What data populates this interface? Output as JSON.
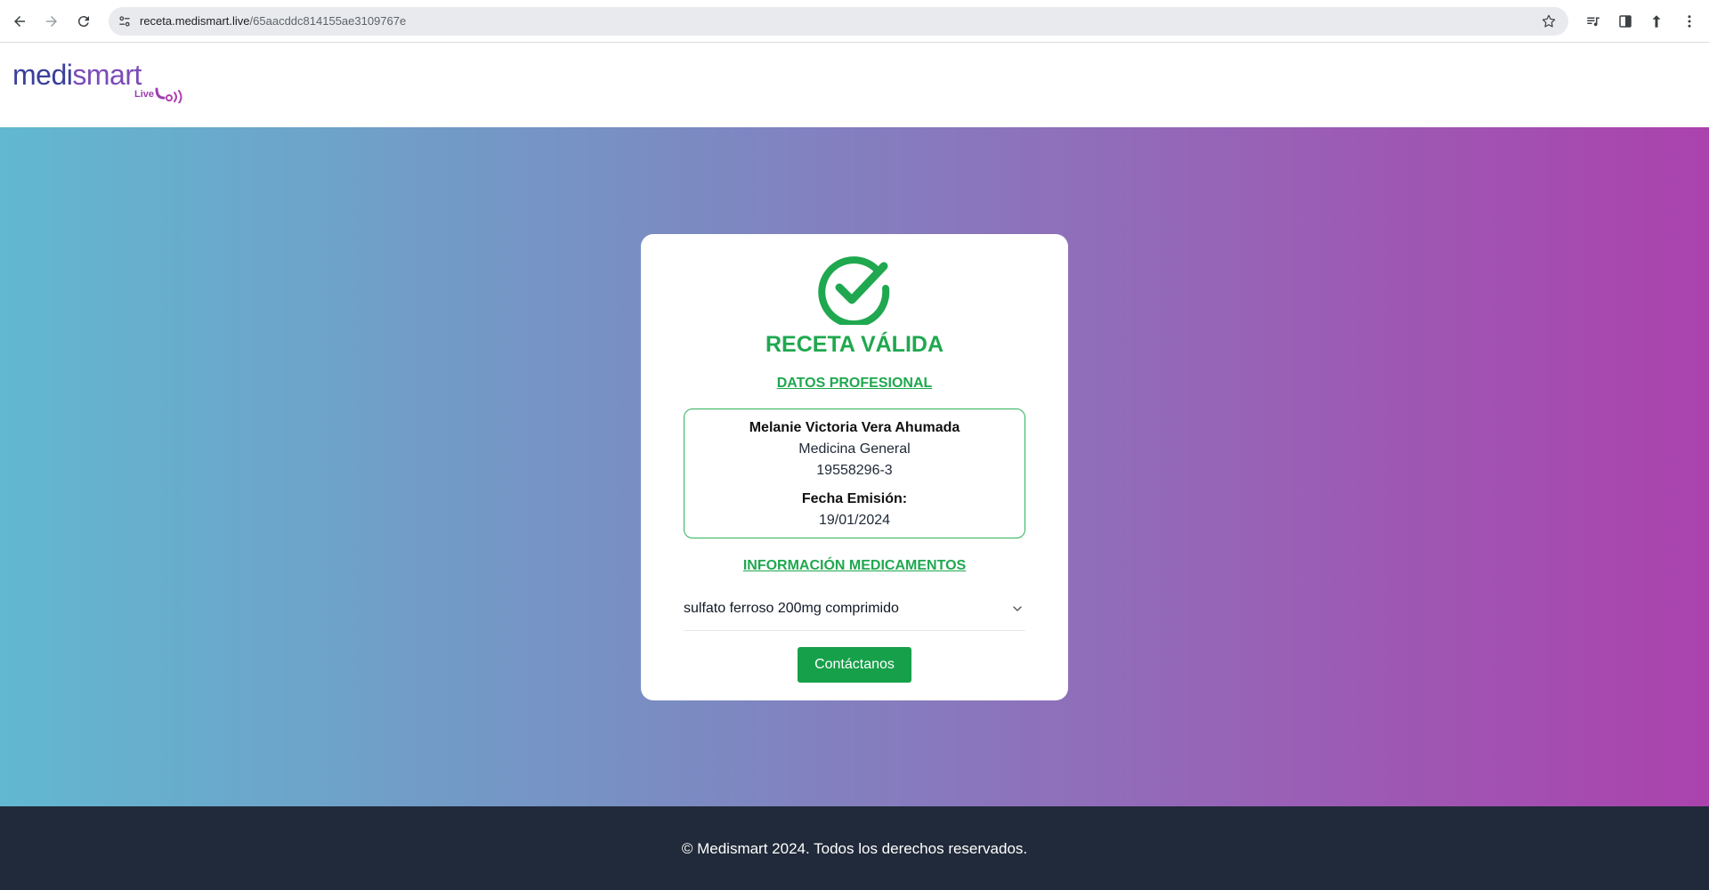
{
  "browser": {
    "url_host": "receta.medismart.live",
    "url_path": "/65aacddc814155ae3109767e",
    "icons": [
      "back-arrow-icon",
      "forward-arrow-icon",
      "reload-icon",
      "site-info-icon",
      "star-icon",
      "media-control-icon",
      "side-panel-icon",
      "update-icon",
      "kebab-menu-icon"
    ]
  },
  "header": {
    "logo_main": "medi",
    "logo_accent": "smart",
    "logo_sub": "Live"
  },
  "card": {
    "status_title": "RECETA VÁLIDA",
    "professional_section": "DATOS PROFESIONAL",
    "professional": {
      "name": "Melanie Victoria Vera Ahumada",
      "specialty": "Medicina General",
      "rut": "19558296-3",
      "date_label": "Fecha Emisión:",
      "date": "19/01/2024"
    },
    "medications_section": "INFORMACIÓN MEDICAMENTOS",
    "medications": [
      {
        "name": "sulfato ferroso 200mg comprimido"
      }
    ],
    "contact_button": "Contáctanos"
  },
  "footer": {
    "copyright": "© Medismart 2024. Todos los derechos reservados."
  },
  "colors": {
    "accent_green": "#1fa84f",
    "button_green": "#17a04a",
    "footer_bg": "#212a3a",
    "gradient_start": "#62b8d0",
    "gradient_end": "#ab42ad"
  }
}
